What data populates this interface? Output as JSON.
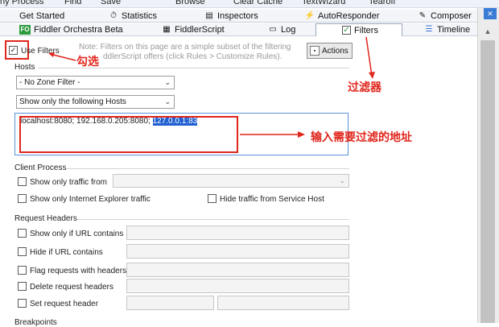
{
  "toolbar": {
    "items": [
      "ny Process",
      "Find",
      "Save",
      "Browse",
      "Clear Cache",
      "TextWizard",
      "Tearoff"
    ]
  },
  "tabs_row1": [
    {
      "label": "Get Started",
      "icon": "none"
    },
    {
      "label": "Statistics",
      "icon": "stopwatch-icon"
    },
    {
      "label": "Inspectors",
      "icon": "inspect-icon"
    },
    {
      "label": "AutoResponder",
      "icon": "lightning-icon"
    },
    {
      "label": "Composer",
      "icon": "compose-icon"
    }
  ],
  "tabs_row2": [
    {
      "label": "Fiddler Orchestra Beta",
      "icon": "fo-icon",
      "badge": "FO"
    },
    {
      "label": "FiddlerScript",
      "icon": "script-icon"
    },
    {
      "label": "Log",
      "icon": "log-icon"
    },
    {
      "label": "Filters",
      "icon": "check-icon",
      "active": true
    },
    {
      "label": "Timeline",
      "icon": "timeline-icon"
    }
  ],
  "filters": {
    "use_filters_label": "Use Filters",
    "use_filters_checked": true,
    "note": "Note: Filters on this page are a simple subset of the filtering ... ddlerScript offers (click Rules > Customize Rules).",
    "note_line1": "Note: Filters on this page are a simple subset of the filtering",
    "note_line2": "ddlerScript offers (click Rules > Customize Rules).",
    "actions_label": "Actions",
    "hosts_header": "Hosts",
    "zone_filter": "- No Zone Filter -",
    "host_filter": "Show only the following Hosts",
    "hosts_value_a": "localhost:8080; 192.168.0.205:8080; ",
    "hosts_value_selected": "127.0.0.1:83",
    "client_process_header": "Client Process",
    "show_only_traffic_from": "Show only traffic from",
    "show_only_ie": "Show only Internet Explorer traffic",
    "hide_service_host": "Hide traffic from Service Host",
    "request_headers_header": "Request Headers",
    "show_only_url": "Show only if URL contains",
    "hide_url": "Hide if URL contains",
    "flag_requests": "Flag requests with headers",
    "delete_headers": "Delete request headers",
    "set_header": "Set request header",
    "breakpoints_header": "Breakpoints"
  },
  "annotations": {
    "check": "勾选",
    "filter": "过滤器",
    "input_hosts": "输入需要过滤的地址"
  },
  "colors": {
    "annotation_red": "#e0261c",
    "selection_blue": "#1f5fd1"
  }
}
